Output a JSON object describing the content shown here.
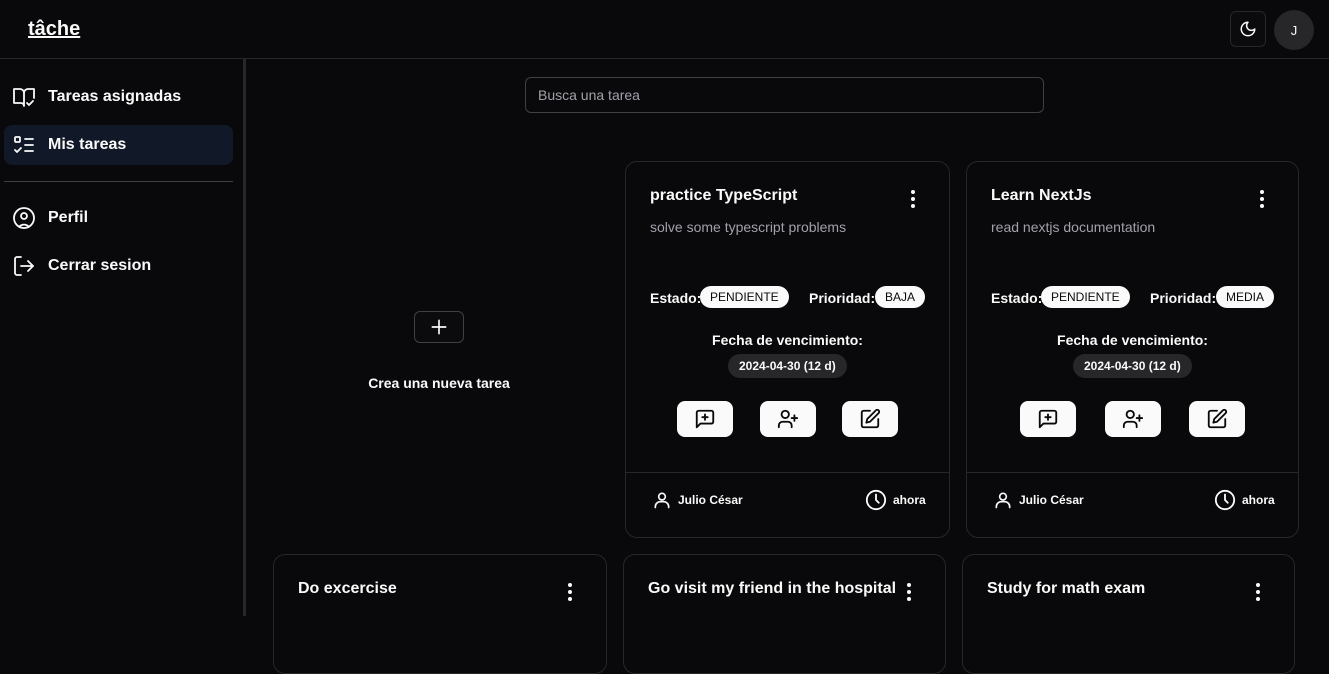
{
  "app": {
    "logo": "tâche",
    "avatar_initial": "J"
  },
  "sidebar": {
    "items": [
      {
        "label": "Tareas asignadas",
        "icon": "book-check-icon",
        "active": false
      },
      {
        "label": "Mis tareas",
        "icon": "list-check-icon",
        "active": true
      },
      {
        "label": "Perfil",
        "icon": "user-circle-icon",
        "active": false
      },
      {
        "label": "Cerrar sesion",
        "icon": "logout-icon",
        "active": false
      }
    ]
  },
  "search": {
    "placeholder": "Busca una tarea",
    "value": ""
  },
  "new_task": {
    "label": "Crea una nueva tarea"
  },
  "labels": {
    "estado": "Estado:",
    "prioridad": "Prioridad:",
    "due": "Fecha de vencimiento:"
  },
  "tasks": [
    {
      "title": "practice TypeScript",
      "description": "solve some typescript problems",
      "status": "PENDIENTE",
      "priority": "BAJA",
      "due": "2024-04-30 (12 d)",
      "owner": "Julio César",
      "time": "ahora"
    },
    {
      "title": "Learn NextJs",
      "description": "read nextjs documentation",
      "status": "PENDIENTE",
      "priority": "MEDIA",
      "due": "2024-04-30 (12 d)",
      "owner": "Julio César",
      "time": "ahora"
    },
    {
      "title": "Do excercise"
    },
    {
      "title": "Go visit my friend in the hospital"
    },
    {
      "title": "Study for math exam"
    }
  ],
  "colors": {
    "background": "#09090b",
    "border": "#27272a",
    "pill": "#fafafa",
    "active_nav": "#111827",
    "muted_text": "#a1a1aa"
  }
}
